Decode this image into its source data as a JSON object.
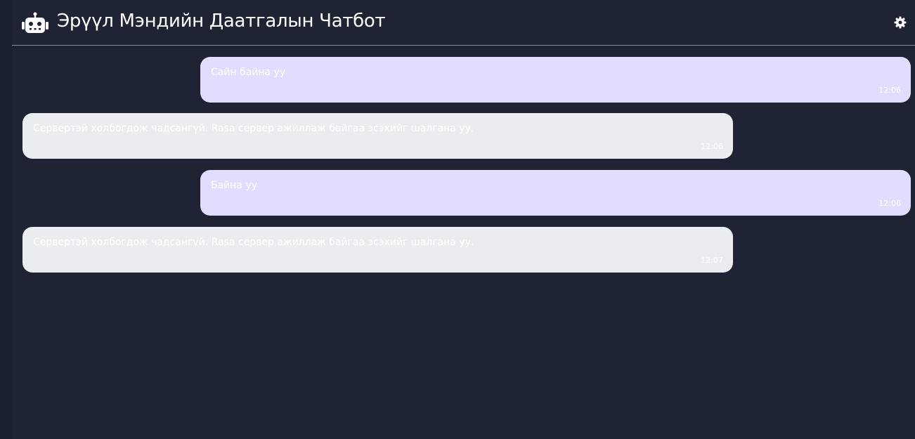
{
  "header": {
    "title": "Эрүүл Мэндийн Даатгалын Чатбот",
    "bot_icon": "robot-icon",
    "settings_icon": "gear-icon"
  },
  "colors": {
    "background": "#1e2433",
    "user_bubble": "#e1ddff",
    "bot_bubble": "#ebecf0",
    "text": "#ffffff"
  },
  "messages": [
    {
      "sender": "user",
      "text": "Сайн байна уу",
      "time": "12:06"
    },
    {
      "sender": "bot",
      "text": "Сервертэй холбогдож чадсангүй. Rasa сервер ажиллаж байгаа эсэхийг шалгана уу.",
      "time": "12:06"
    },
    {
      "sender": "user",
      "text": "Байна уу",
      "time": "12:06"
    },
    {
      "sender": "bot",
      "text": "Сервертэй холбогдож чадсангүй. Rasa сервер ажиллаж байгаа эсэхийг шалгана уу.",
      "time": "12:07"
    }
  ]
}
